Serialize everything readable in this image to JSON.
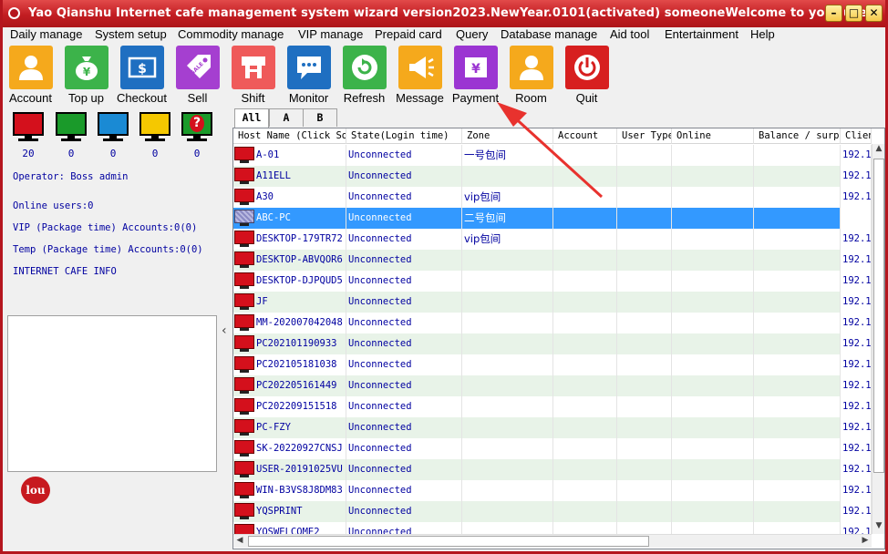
{
  "window": {
    "title": "Yao Qianshu Internet cafe management system wizard version2023.NewYear.0101(activated)  someoneWelcome to your use",
    "min_glyph": "–",
    "max_glyph": "□",
    "close_glyph": "✕"
  },
  "menu": [
    "Daily manage",
    "System setup",
    "Commodity manage",
    "VIP manage",
    "Prepaid card",
    "Query",
    "Database manage",
    "Aid tool",
    "Entertainment",
    "Help"
  ],
  "toolbar": [
    {
      "label": "Account",
      "color": "#f5a91c",
      "icon": "user-icon"
    },
    {
      "label": "Top up",
      "color": "#3cb34a",
      "icon": "money-bag-icon"
    },
    {
      "label": "Checkout",
      "color": "#1f6fc1",
      "icon": "dollar-icon"
    },
    {
      "label": "Sell",
      "color": "#a53fd0",
      "icon": "sale-tag-icon"
    },
    {
      "label": "Shift",
      "color": "#ef5a5a",
      "icon": "handover-icon"
    },
    {
      "label": "Monitor",
      "color": "#1f6fc1",
      "icon": "chat-bubble-icon"
    },
    {
      "label": "Refresh",
      "color": "#3cb34a",
      "icon": "refresh-icon"
    },
    {
      "label": "Message",
      "color": "#f5a91c",
      "icon": "megaphone-icon"
    },
    {
      "label": "Payment",
      "color": "#9b35d2",
      "icon": "yen-card-icon"
    },
    {
      "label": "Room",
      "color": "#f5a91c",
      "icon": "person-icon"
    },
    {
      "label": "Quit",
      "color": "#d71f1f",
      "icon": "power-icon"
    }
  ],
  "status_monitors": [
    {
      "color": "#d4101c",
      "count": "20"
    },
    {
      "color": "#1a9a2a",
      "count": "0"
    },
    {
      "color": "#1a8ad4",
      "count": "0"
    },
    {
      "color": "#f5c800",
      "count": "0"
    },
    {
      "color": "#1a9a2a",
      "count": "0",
      "glyph": "?"
    }
  ],
  "left_info": {
    "operator": "Operator: Boss admin",
    "online": "Online users:0",
    "vip": "VIP (Package time) Accounts:0(0)",
    "temp": "Temp (Package time) Accounts:0(0)",
    "cafe_info": "INTERNET CAFE  INFO",
    "logo_text": "lou"
  },
  "tabs": [
    "All",
    "A",
    "B"
  ],
  "columns": [
    "Host Name (Click Sort)",
    "State(Login time)",
    "Zone",
    "Account",
    "User Type",
    "Online",
    "Balance / surplus",
    "Client"
  ],
  "rows": [
    {
      "host": "A-01",
      "state": "Unconnected",
      "zone": "一号包间",
      "client": "192.1"
    },
    {
      "host": "A11ELL",
      "state": "Unconnected",
      "zone": "",
      "client": "192.1"
    },
    {
      "host": "A30",
      "state": "Unconnected",
      "zone": "vip包间",
      "client": "192.1"
    },
    {
      "host": "ABC-PC",
      "state": "Unconnected",
      "zone": "二号包间",
      "client": "192.1",
      "selected": true
    },
    {
      "host": "DESKTOP-179TR72",
      "state": "Unconnected",
      "zone": "vip包间",
      "client": "192.1"
    },
    {
      "host": "DESKTOP-ABVQOR6",
      "state": "Unconnected",
      "zone": "",
      "client": "192.1"
    },
    {
      "host": "DESKTOP-DJPQUD5",
      "state": "Unconnected",
      "zone": "",
      "client": "192.1"
    },
    {
      "host": "JF",
      "state": "Unconnected",
      "zone": "",
      "client": "192.1"
    },
    {
      "host": "MM-202007042048",
      "state": "Unconnected",
      "zone": "",
      "client": "192.1"
    },
    {
      "host": "PC202101190933",
      "state": "Unconnected",
      "zone": "",
      "client": "192.1"
    },
    {
      "host": "PC202105181038",
      "state": "Unconnected",
      "zone": "",
      "client": "192.1"
    },
    {
      "host": "PC202205161449",
      "state": "Unconnected",
      "zone": "",
      "client": "192.1"
    },
    {
      "host": "PC202209151518",
      "state": "Unconnected",
      "zone": "",
      "client": "192.1"
    },
    {
      "host": "PC-FZY",
      "state": "Unconnected",
      "zone": "",
      "client": "192.1"
    },
    {
      "host": "SK-20220927CNSJ",
      "state": "Unconnected",
      "zone": "",
      "client": "192.1"
    },
    {
      "host": "USER-20191025VU",
      "state": "Unconnected",
      "zone": "",
      "client": "192.1"
    },
    {
      "host": "WIN-B3VS8J8DM83",
      "state": "Unconnected",
      "zone": "",
      "client": "192.1"
    },
    {
      "host": "YQSPRINT",
      "state": "Unconnected",
      "zone": "",
      "client": "192.1"
    },
    {
      "host": "YQSWELCOME2",
      "state": "Unconnected",
      "zone": "",
      "client": "192.1"
    }
  ],
  "accent_colors": {
    "titlebar": "#c21d22",
    "selection": "#3399ff",
    "alt_row": "#e8f3e8",
    "annotation_arrow": "#e8322e"
  }
}
